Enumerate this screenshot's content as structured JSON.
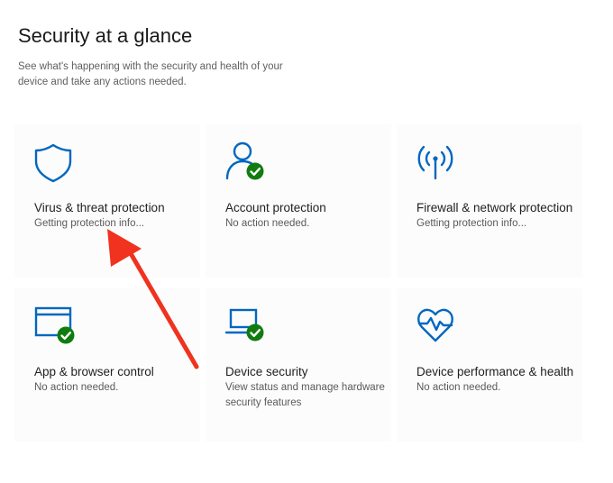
{
  "header": {
    "title": "Security at a glance",
    "subtitle": "See what's happening with the security and health of your device and take any actions needed."
  },
  "colors": {
    "icon_blue": "#0067c0",
    "check_green": "#107c10",
    "arrow_red": "#f0321e"
  },
  "tiles": [
    {
      "name": "Virus & threat protection",
      "status": "Getting protection info...",
      "icon": "shield-icon"
    },
    {
      "name": "Account protection",
      "status": "No action needed.",
      "icon": "account-icon"
    },
    {
      "name": "Firewall & network protection",
      "status": "Getting protection info...",
      "icon": "network-antenna-icon"
    },
    {
      "name": "App & browser control",
      "status": "No action needed.",
      "icon": "browser-window-icon"
    },
    {
      "name": "Device security",
      "status": "View status and manage hardware security features",
      "icon": "laptop-icon"
    },
    {
      "name": "Device performance & health",
      "status": "No action needed.",
      "icon": "heart-pulse-icon"
    }
  ]
}
